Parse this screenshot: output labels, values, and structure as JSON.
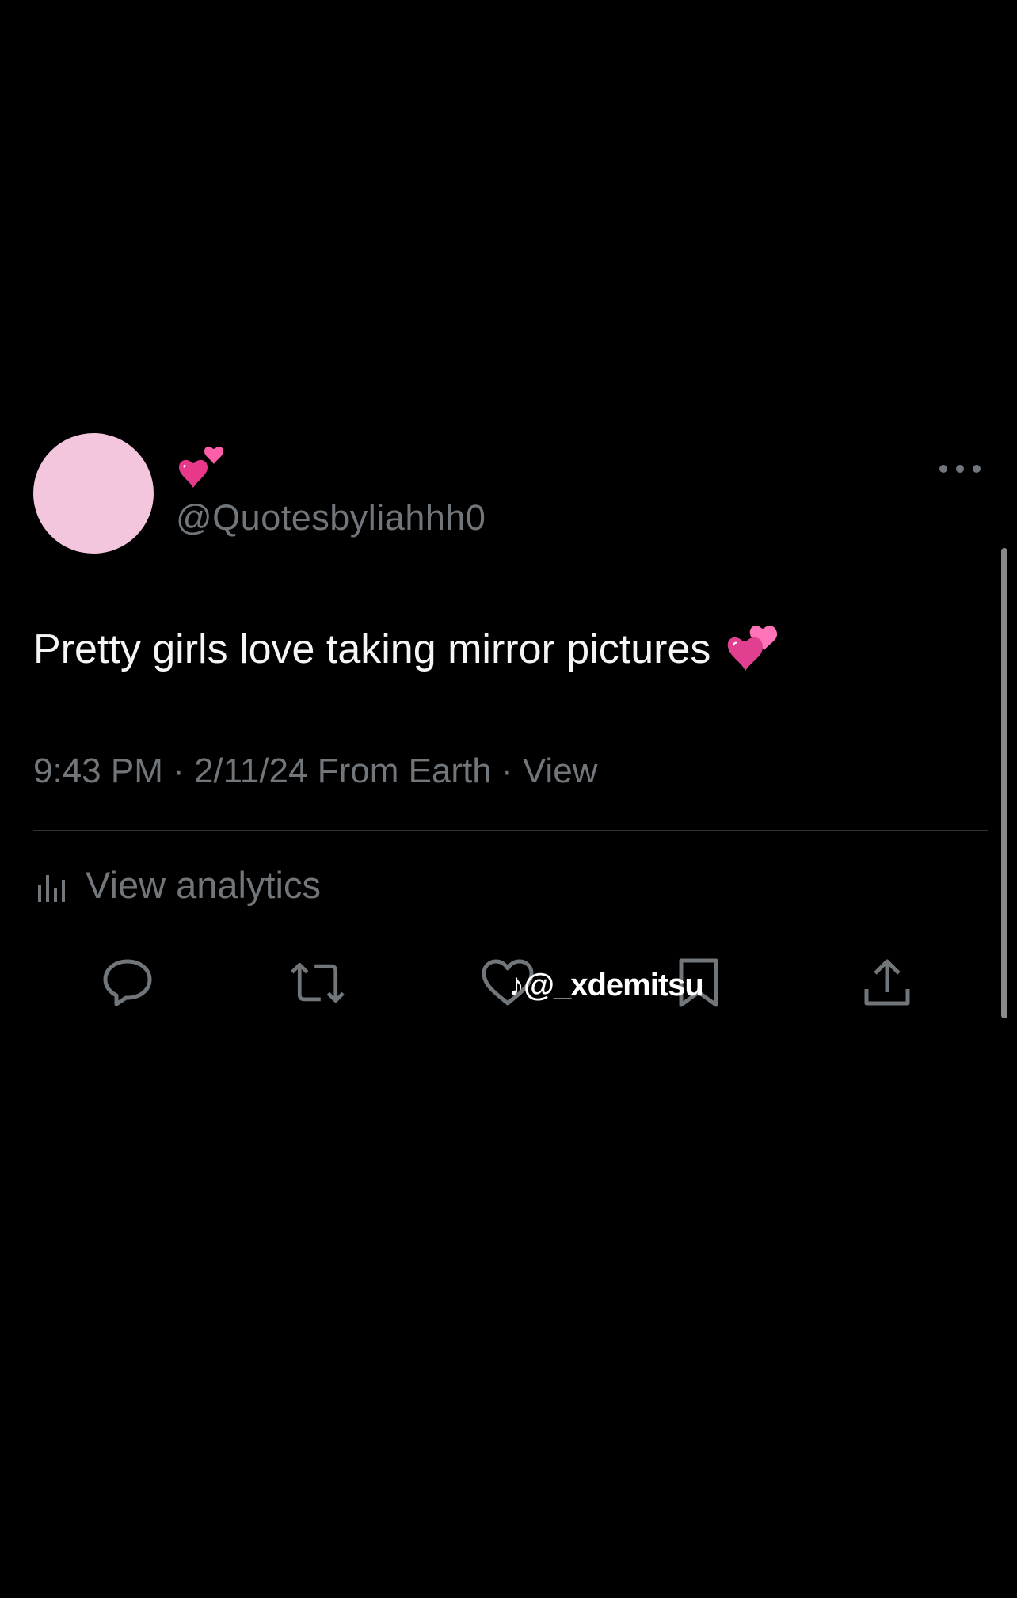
{
  "tweet": {
    "display_name_emoji": "heart-pair-emoji",
    "handle": "@Quotesbyliahhh0",
    "text": "Pretty girls love taking mirror pictures",
    "text_emoji": "revolving-hearts-emoji",
    "meta": "9:43 PM · 2/11/24 From Earth · View",
    "analytics_label": "View analytics"
  },
  "actions": [
    {
      "name": "reply",
      "icon": "reply-icon"
    },
    {
      "name": "retweet",
      "icon": "retweet-icon"
    },
    {
      "name": "like",
      "icon": "heart-icon"
    },
    {
      "name": "bookmark",
      "icon": "bookmark-icon"
    },
    {
      "name": "share",
      "icon": "share-icon"
    }
  ],
  "watermark": {
    "text": "@_xdemitsu"
  },
  "colors": {
    "background": "#000000",
    "avatar": "#f4c6dd",
    "secondary_text": "#71767b",
    "primary_text": "#f5f5f5",
    "emoji_pink": "#e83e8c",
    "divider": "#2f3336"
  }
}
